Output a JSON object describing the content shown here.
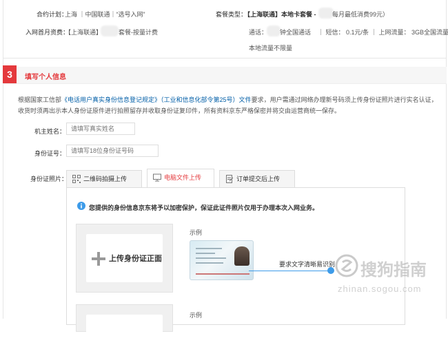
{
  "plan": {
    "contract_label": "合约计划：",
    "contract_value": "上海 ｜中国联通｜“选号入网”",
    "package_type_label": "套餐类型：",
    "package_type_value": "【上海联通】本地卡套餐 -",
    "package_type_note": "每月最低消费99元）",
    "first_month_label": "入网首月资费：",
    "first_month_value": "【上海联通】",
    "first_month_suffix": "套餐-按量计费",
    "details_call": "通话：",
    "details_call_suffix": "钟全国通话",
    "details_sms": "｜ 短信： 0.1元/条",
    "details_data": "｜ 上网流量： 3GB全国流量",
    "details_local": "本地流量不限量"
  },
  "section": {
    "step": "3",
    "title": "填写个人信息"
  },
  "notice": {
    "prefix": "根据国家工信部",
    "link1": "《电话用户真实身份信息登记规定》",
    "link2": "（工业和信息化部令第25号）",
    "link3": "文件",
    "suffix": "要求，用户需通过网络办理新号码须上传身份证照片进行实名认证，收货时须再出示本人身份证原件进行拍照留存并收取身份证复印件，所有资料京东严格保密并将交由运营商统一保存。"
  },
  "form": {
    "name_label": "机主姓名：",
    "name_placeholder": "请填写真实姓名",
    "id_label": "身份证号：",
    "id_placeholder": "请填写18位身份证号码",
    "photo_label": "身份证照片："
  },
  "tabs": [
    {
      "label": "二维码拍摄上传",
      "icon": "qrcode-icon"
    },
    {
      "label": "电脑文件上传",
      "icon": "monitor-icon"
    },
    {
      "label": "订单提交后上传",
      "icon": "document-icon"
    }
  ],
  "upload": {
    "info_text": "您提供的身份信息京东将予以加密保护，保证此证件照片仅用于办理本次入网业务。",
    "front_label": "上传身份证正面",
    "example_label": "示例",
    "example_label_2": "示例",
    "callout_text": "要求文字清晰易识别"
  },
  "watermark": {
    "brand": "搜狗指南",
    "url": "zhinan.sogou.com"
  },
  "colors": {
    "accent": "#e4393c",
    "link": "#005ea7",
    "info": "#3d9be9"
  }
}
